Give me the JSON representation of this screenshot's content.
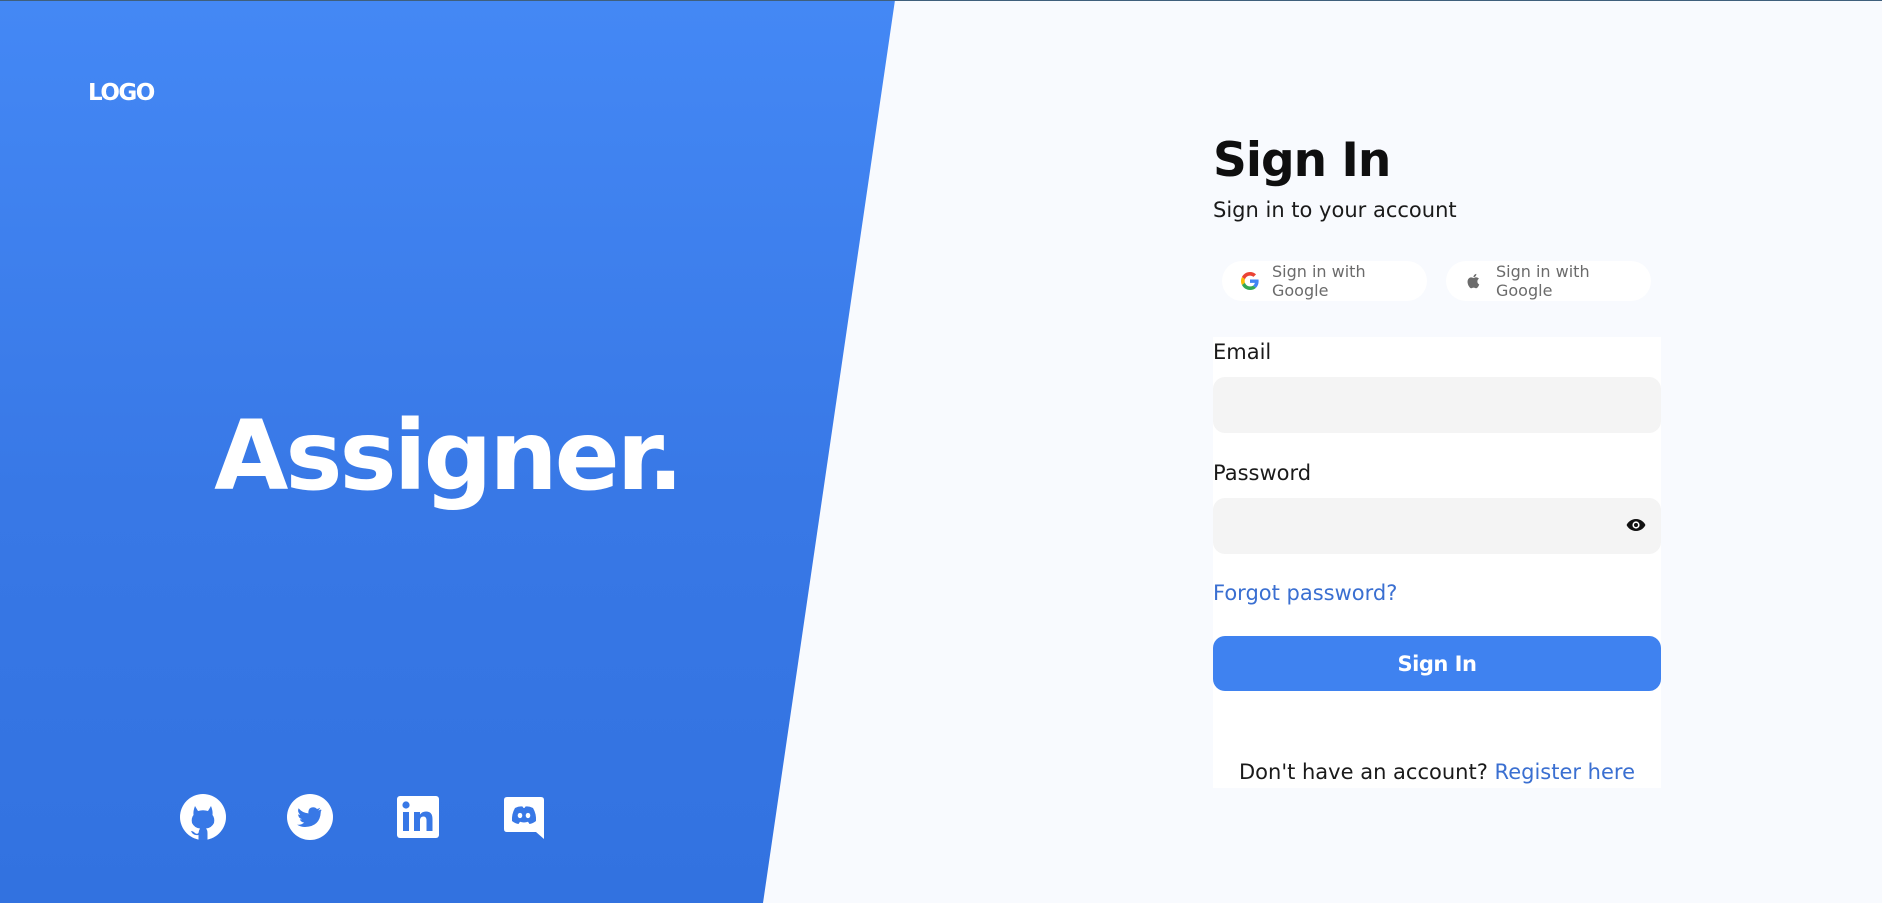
{
  "brand": {
    "logo_text": "LOGO",
    "name": "Assigner.",
    "accent_color": "#3f82f0",
    "panel_color": "#3878e6"
  },
  "social_links": [
    {
      "icon": "github-icon"
    },
    {
      "icon": "twitter-icon"
    },
    {
      "icon": "linkedin-icon"
    },
    {
      "icon": "discord-icon"
    }
  ],
  "signin": {
    "title": "Sign In",
    "subtitle": "Sign in to your account",
    "oauth": [
      {
        "icon": "google-icon",
        "label": "Sign in with Google"
      },
      {
        "icon": "apple-icon",
        "label": "Sign in with Google"
      }
    ],
    "email_label": "Email",
    "email_value": "",
    "password_label": "Password",
    "password_value": "",
    "forgot_label": "Forgot password?",
    "submit_label": "Sign In",
    "register_prompt": "Don't have an account?",
    "register_link": "Register here"
  }
}
